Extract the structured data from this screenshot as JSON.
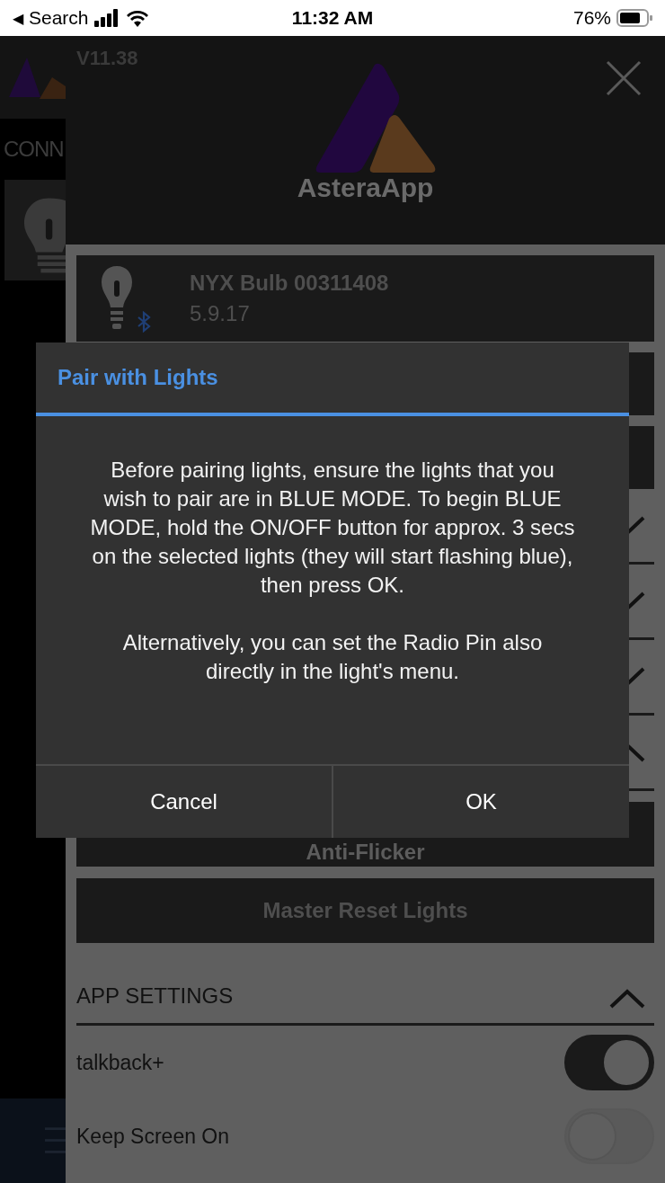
{
  "status_bar": {
    "back_arrow": "◀",
    "back_label": "Search",
    "time": "11:32 AM",
    "battery": "76%"
  },
  "background_app": {
    "section_label": "CONN"
  },
  "drawer": {
    "version": "V11.38",
    "logo_text": "AsteraApp",
    "device": {
      "name": "NYX Bulb 00311408",
      "firmware": "5.9.17",
      "bluetooth": true
    },
    "sections": [
      {
        "expanded": false
      },
      {
        "expanded": false
      },
      {
        "expanded": false
      },
      {
        "expanded": true
      }
    ],
    "buttons": [
      "Anti-Flicker",
      "Master Reset Lights"
    ],
    "app_settings": {
      "title": "APP SETTINGS",
      "expanded": true,
      "toggles": [
        {
          "label": "talkback+",
          "on": true
        },
        {
          "label": "Keep Screen On",
          "on": false
        }
      ]
    }
  },
  "dialog": {
    "title": "Pair with Lights",
    "paragraphs": [
      "Before pairing lights, ensure the lights that you wish to pair are in BLUE MODE. To begin BLUE MODE, hold the ON/OFF button for approx. 3 secs on the selected lights (they will start flashing blue), then press OK.",
      "Alternatively, you can set the Radio Pin also directly in the light's menu."
    ],
    "buttons": [
      "Cancel",
      "OK"
    ]
  }
}
